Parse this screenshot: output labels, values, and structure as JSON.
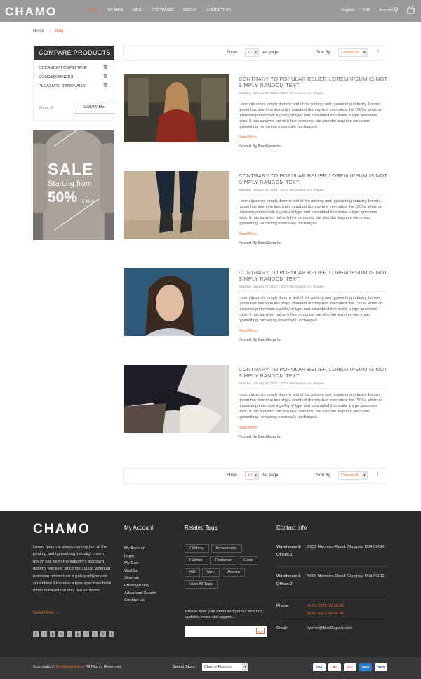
{
  "header": {
    "logo": "CHAMO",
    "nav": [
      "HOME",
      "WOMEN",
      "MEN",
      "FOOTWEAR",
      "PAGES",
      "CONTACT US"
    ],
    "language": "English",
    "currency": "GBP",
    "account": "Account"
  },
  "breadcrumb": {
    "home": "Home",
    "current": "Blog"
  },
  "compare": {
    "title": "COMPARE PRODUCTS",
    "items": [
      "OCCAECATI CUPIDITATE",
      "CONSEQUENCES",
      "PLEASURE RATIONALLY"
    ],
    "clear_all": "Clear all",
    "button": "COMPARE"
  },
  "banner": {
    "headline": "SALE",
    "line": "Starting from",
    "percent": "50%",
    "suffix": "OFF"
  },
  "toolbar": {
    "show_label": "Show",
    "show_value": "10",
    "per_page": "per page",
    "sort_label": "Sort By",
    "sort_value": "Created At"
  },
  "posts": [
    {
      "title": "CONTRARY TO POPULAR BELIEF, LOREM IPSUM IS NOT SIMPLY RANDOM TEXT.",
      "meta": "Saturday, January 20, 2018 1:06:07 AM Amazon Lin, Shopee",
      "excerpt": "Lorem Ipsum is simply dummy text of the printing and typesetting industry. Lorem Ipsum has been the industry's standard dummy text ever since the 1500s, when an unknown printer took a galley of type and scrambled it to make a type specimen book. It has survived not only five centuries, but also the leap into electronic typesetting, remaining essentially unchanged.",
      "read_more": "Read More",
      "posted_by": "Posted By BootExperts"
    },
    {
      "title": "CONTRARY TO POPULAR BELIEF, LOREM IPSUM IS NOT SIMPLY RANDOM TEXT.",
      "meta": "Saturday, January 20, 2018 1:06:07 AM Amazon Lin, Shopee",
      "excerpt": "Lorem Ipsum is simply dummy text of the printing and typesetting industry. Lorem Ipsum has been the industry's standard dummy text ever since the 1500s, when an unknown printer took a galley of type and scrambled it to make a type specimen book. It has survived not only five centuries, but also the leap into electronic typesetting, remaining essentially unchanged.",
      "read_more": "Read More",
      "posted_by": "Posted By BootExperts"
    },
    {
      "title": "CONTRARY TO POPULAR BELIEF, LOREM IPSUM IS NOT SIMPLY RANDOM TEXT.",
      "meta": "Saturday, January 20, 2018 1:06:07 AM Amazon Lin, Shopee",
      "excerpt": "Lorem Ipsum is simply dummy text of the printing and typesetting industry. Lorem Ipsum has been the industry's standard dummy text ever since the 1500s, when an unknown printer took a galley of type and scrambled it to make a type specimen book. It has survived not only five centuries, but also the leap into electronic typesetting, remaining essentially unchanged.",
      "read_more": "Read More",
      "posted_by": "Posted By BootExperts"
    },
    {
      "title": "CONTRARY TO POPULAR BELIEF, LOREM IPSUM IS NOT SIMPLY RANDOM TEXT.",
      "meta": "Saturday, January 20, 2018 1:06:07 AM Amazon Lin, Shopee",
      "excerpt": "Lorem Ipsum is simply dummy text of the printing and typesetting industry. Lorem Ipsum has been the industry's standard dummy text ever since the 1500s, when an unknown printer took a galley of type and scrambled it to make a type specimen book. It has survived not only five centuries, but also the leap into electronic typesetting, remaining essentially unchanged.",
      "read_more": "Read More",
      "posted_by": "Posted By BootExperts"
    }
  ],
  "footer": {
    "logo": "CHAMO",
    "about": "Lorem Ipsum is simply dummy text of the printing and typesetting industry. Lorem Ipsum has been the industry's standard dummy text ever since the 1500s, when an unknown printer took a galley of type and scrambled it to make a type specimen book. It has survived not only five centuries.",
    "read_more": "Read More",
    "account_title": "My Account",
    "account_links": [
      "My Account",
      "Login",
      "My Cart",
      "Wishlist",
      "Sitemap",
      "Privacy Policy",
      "Advanced Search",
      "Contact Us"
    ],
    "tags_title": "Related Tags",
    "tags": [
      "Clothing",
      "Accessories",
      "Fashion",
      "Footwear",
      "Good",
      "Kid",
      "Men",
      "Women",
      "View All Tags"
    ],
    "newsletter_text": "Please write your email and get our amazing updates, news and support...",
    "contact_title": "Contact Info",
    "warehouse1_label": "Warehouse & Offices 1",
    "warehouse1": "8901 Marmora Road, Glasgow, D04 89GR",
    "warehouse2_label": "Warehouse & Offices 2",
    "warehouse2": "8669 Marmora Road, Glasgow, D04 89GR",
    "phone_label": "Phone:",
    "phone1": "(+88) 0173 35 66 86",
    "phone2": "(+88) 0173 35 66 86",
    "email_label": "Email:",
    "email": "Admin@BootExpert.com",
    "copyright_pre": "Copyright ©",
    "copyright_brand": "BootExpert.com",
    "copyright_post": "All Rights Reserved.",
    "store_label": "Select Store:",
    "store_value": "Chamo Fashion"
  },
  "colors": {
    "accent": "#e8703a",
    "header": "#9b9b9b",
    "footer": "#2b2b2b"
  }
}
